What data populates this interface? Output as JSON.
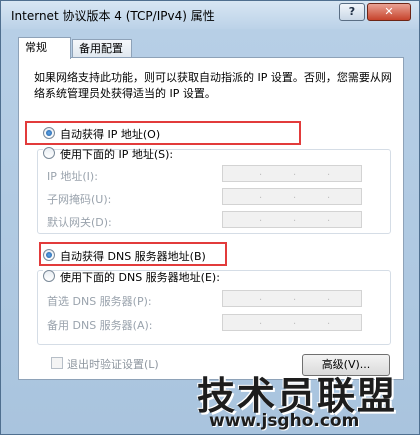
{
  "window": {
    "title": "Internet 协议版本 4 (TCP/IPv4) 属性",
    "help_label": "?",
    "close_label": "✕"
  },
  "tabs": [
    {
      "label": "常规",
      "active": true
    },
    {
      "label": "备用配置",
      "active": false
    }
  ],
  "general": {
    "description": "如果网络支持此功能，则可以获取自动指派的 IP 设置。否则，您需要从网络系统管理员处获得适当的 IP 设置。",
    "ip_auto": {
      "label": "自动获得 IP 地址(O)",
      "checked": true
    },
    "ip_manual": {
      "label": "使用下面的 IP 地址(S):",
      "checked": false
    },
    "ip_fields": [
      {
        "label": "IP 地址(I):",
        "value": ".    .    ."
      },
      {
        "label": "子网掩码(U):",
        "value": ".    .    ."
      },
      {
        "label": "默认网关(D):",
        "value": ".    .    ."
      }
    ],
    "dns_auto": {
      "label": "自动获得 DNS 服务器地址(B)",
      "checked": true
    },
    "dns_manual": {
      "label": "使用下面的 DNS 服务器地址(E):",
      "checked": false
    },
    "dns_fields": [
      {
        "label": "首选 DNS 服务器(P):",
        "value": ".    .    ."
      },
      {
        "label": "备用 DNS 服务器(A):",
        "value": ".    .    ."
      }
    ],
    "validate_label": "退出时验证设置(L)",
    "advanced_label": "高级(V)..."
  },
  "watermark": {
    "title": "技术员联盟",
    "url": "www.jsgho.com"
  },
  "colors": {
    "highlight": "#e23b3b",
    "panel": "#ffffff",
    "window": "#b7cfe6"
  }
}
